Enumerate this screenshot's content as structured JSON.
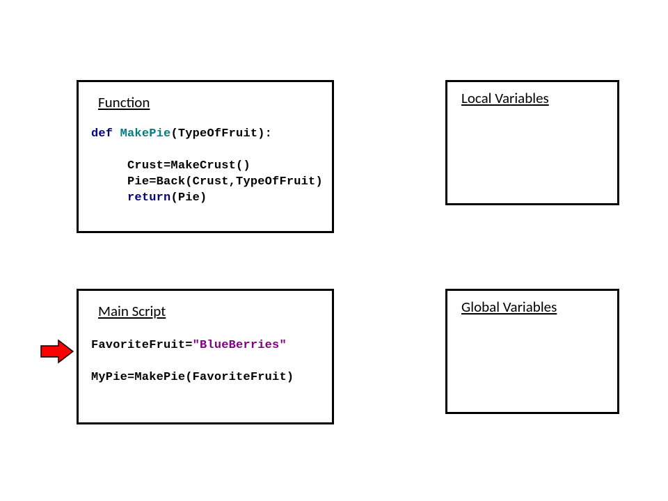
{
  "function_box": {
    "title": "Function",
    "code": {
      "def_kw": "def",
      "func_name": "MakePie",
      "params": "(TypeOfFruit):",
      "line1": "Crust=MakeCrust()",
      "line2": "Pie=Back(Crust,TypeOfFruit)",
      "return_kw": "return",
      "return_tail": "(Pie)"
    }
  },
  "mainscript_box": {
    "title": "Main Script",
    "code": {
      "assign_lhs": "FavoriteFruit=",
      "assign_str": "\"BlueBerries\"",
      "line2": "MyPie=MakePie(FavoriteFruit)"
    }
  },
  "localvars_box": {
    "title": "Local Variables"
  },
  "globalvars_box": {
    "title": "Global Variables"
  },
  "arrow": {
    "label": "current-line-pointer"
  }
}
